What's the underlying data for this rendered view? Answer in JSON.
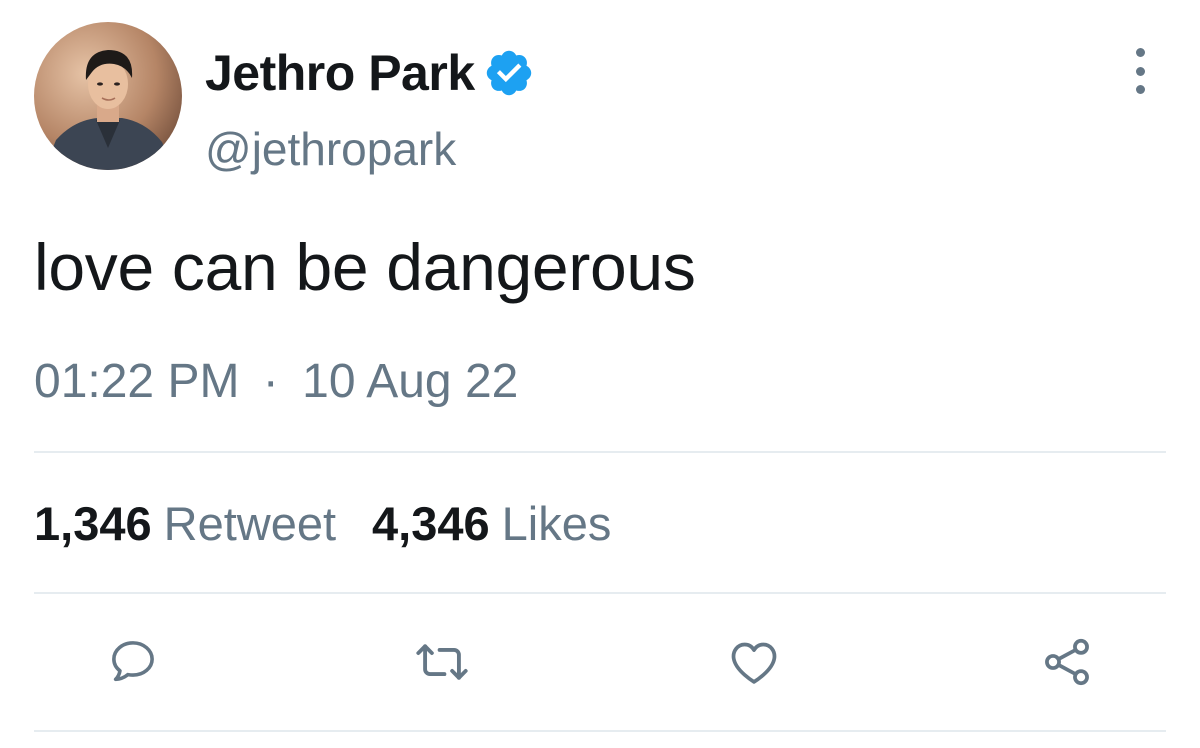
{
  "user": {
    "display_name": "Jethro Park",
    "handle": "@jethropark",
    "verified": true,
    "avatar_icon": "profile-photo"
  },
  "tweet": {
    "text": "love can be dangerous",
    "time": "01:22 PM",
    "separator": "·",
    "date": "10 Aug 22"
  },
  "stats": {
    "retweets_count": "1,346",
    "retweets_label": "Retweet",
    "likes_count": "4,346",
    "likes_label": "Likes"
  },
  "actions": [
    {
      "name": "reply",
      "icon": "speech-bubble-icon"
    },
    {
      "name": "retweet",
      "icon": "retweet-arrows-icon"
    },
    {
      "name": "like",
      "icon": "heart-icon"
    },
    {
      "name": "share",
      "icon": "share-nodes-icon"
    }
  ],
  "colors": {
    "verified_badge": "#1da1f2",
    "primary_text": "#14171a",
    "secondary_text": "#657786",
    "divider": "#e6ecf0"
  }
}
